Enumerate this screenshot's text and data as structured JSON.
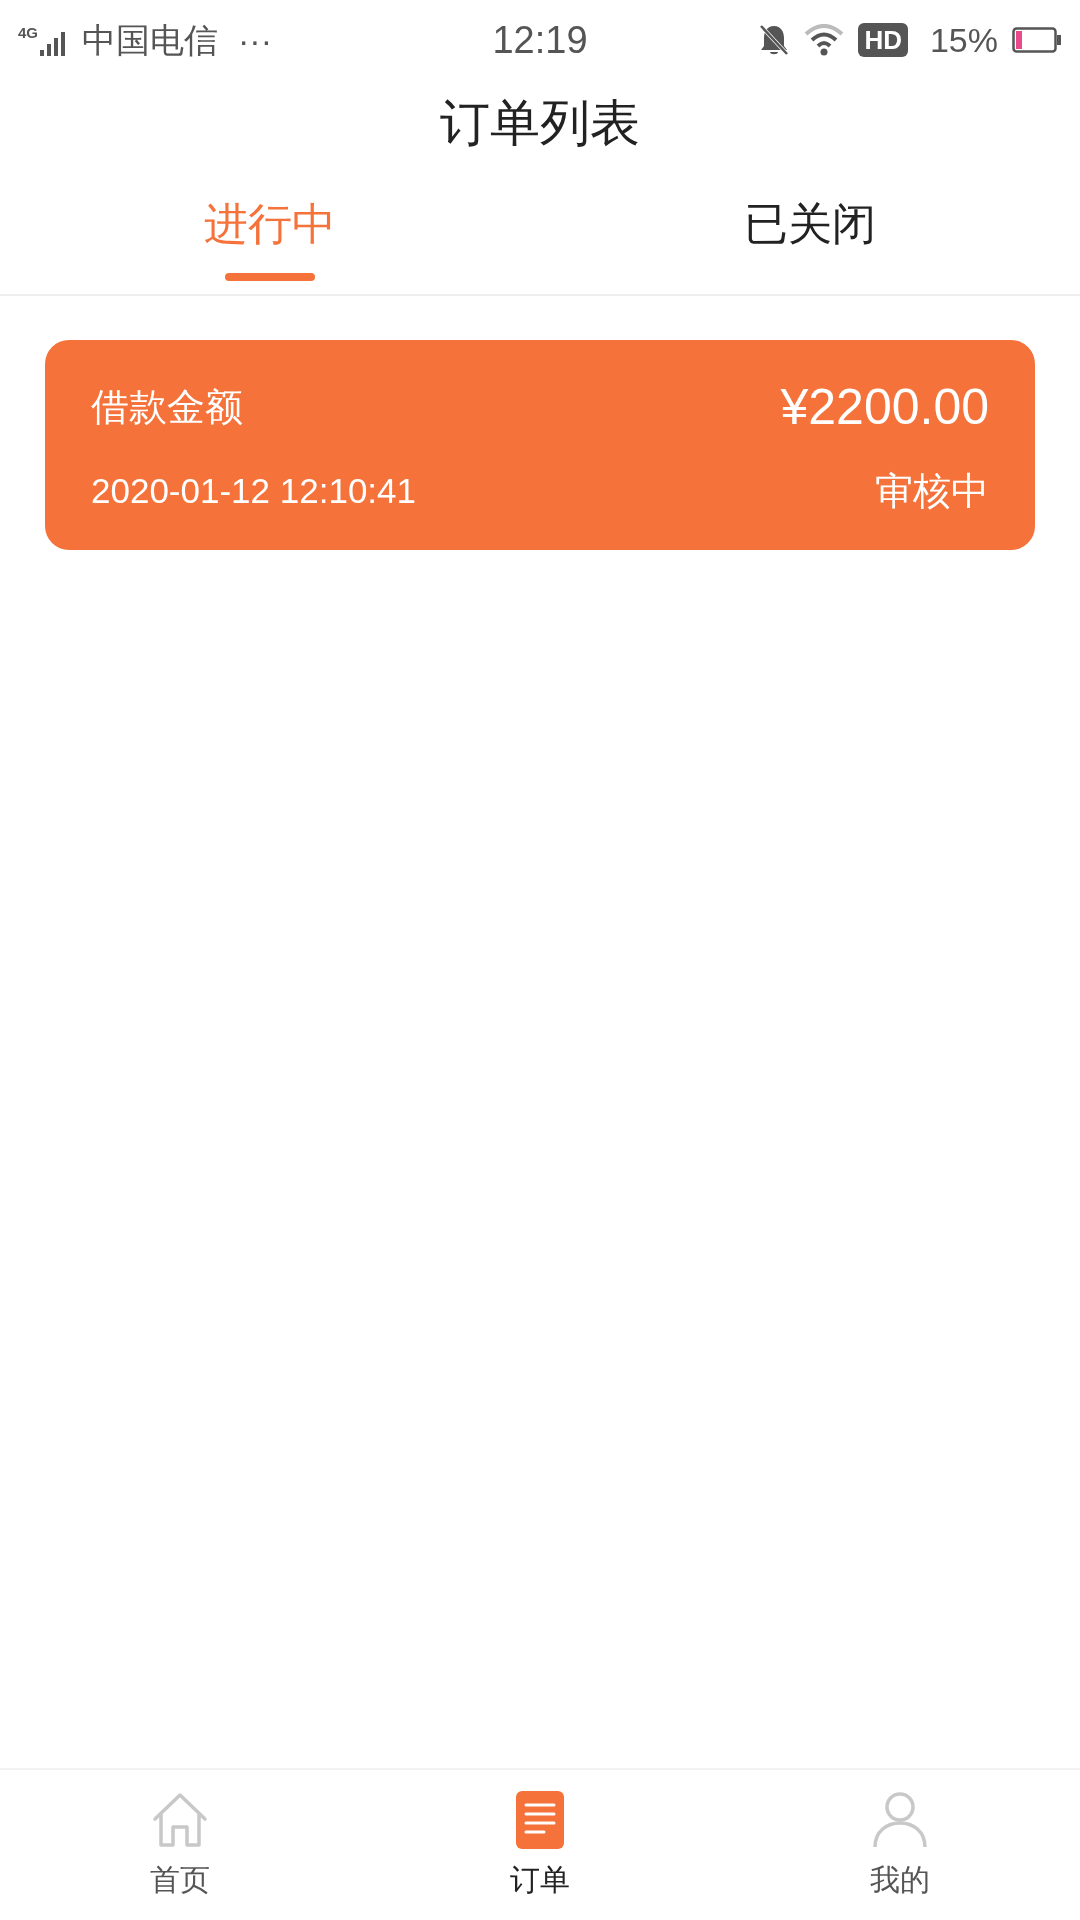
{
  "status_bar": {
    "network": "4G",
    "carrier": "中国电信",
    "more": "···",
    "time": "12:19",
    "hd": "HD",
    "battery": "15%"
  },
  "title": "订单列表",
  "tabs": [
    {
      "label": "进行中",
      "selected": true
    },
    {
      "label": "已关闭",
      "selected": false
    }
  ],
  "orders": [
    {
      "label": "借款金额",
      "amount": "¥2200.00",
      "time": "2020-01-12 12:10:41",
      "status": "审核中"
    }
  ],
  "bottom_nav": [
    {
      "label": "首页",
      "kind": "home",
      "selected": false
    },
    {
      "label": "订单",
      "kind": "orders",
      "selected": true
    },
    {
      "label": "我的",
      "kind": "profile",
      "selected": false
    }
  ]
}
